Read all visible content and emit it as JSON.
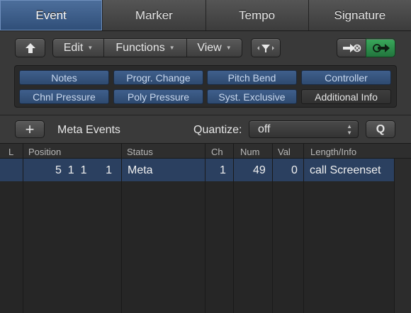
{
  "tabs": [
    {
      "label": "Event",
      "active": true
    },
    {
      "label": "Marker",
      "active": false
    },
    {
      "label": "Tempo",
      "active": false
    },
    {
      "label": "Signature",
      "active": false
    }
  ],
  "toolbar": {
    "edit": "Edit",
    "functions": "Functions",
    "view": "View"
  },
  "filters": [
    {
      "label": "Notes",
      "on": true
    },
    {
      "label": "Progr. Change",
      "on": true
    },
    {
      "label": "Pitch Bend",
      "on": true
    },
    {
      "label": "Controller",
      "on": true
    },
    {
      "label": "Chnl Pressure",
      "on": true
    },
    {
      "label": "Poly Pressure",
      "on": true
    },
    {
      "label": "Syst. Exclusive",
      "on": true
    },
    {
      "label": "Additional Info",
      "on": false
    }
  ],
  "metabar": {
    "add": "+",
    "title": "Meta Events",
    "quantize_label": "Quantize:",
    "quantize_value": "off",
    "q_button": "Q"
  },
  "table": {
    "headers": [
      "L",
      "Position",
      "Status",
      "Ch",
      "Num",
      "Val",
      "Length/Info"
    ],
    "rows": [
      {
        "position": "5  1  1      1",
        "status": "Meta",
        "ch": "1",
        "num": "49",
        "val": "0",
        "info": "call Screenset"
      }
    ]
  },
  "colors": {
    "accent": "#3f5f8c",
    "selected_row": "#2b4060",
    "green_button": "#2e8a4a"
  }
}
